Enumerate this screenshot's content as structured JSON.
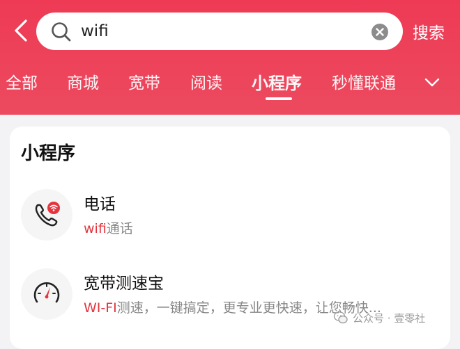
{
  "search": {
    "query": "wifi",
    "button_label": "搜索"
  },
  "tabs": [
    {
      "label": "全部",
      "active": false
    },
    {
      "label": "商城",
      "active": false
    },
    {
      "label": "宽带",
      "active": false
    },
    {
      "label": "阅读",
      "active": false
    },
    {
      "label": "小程序",
      "active": true
    },
    {
      "label": "秒懂联通",
      "active": false
    }
  ],
  "section": {
    "title": "小程序",
    "items": [
      {
        "title": "电话",
        "desc_highlight": "wifi",
        "desc_rest": "通话",
        "icon": "wifi-call-icon"
      },
      {
        "title": "宽带测速宝",
        "desc_highlight": "WI-FI",
        "desc_rest": "测速，一键搞定，更专业更快速，让您畅快...",
        "icon": "speedometer-icon"
      }
    ]
  },
  "watermark": {
    "text": "公众号 · 壹零社"
  },
  "colors": {
    "header": "#ee3a55",
    "highlight": "#e5343e",
    "card": "#ffffff"
  }
}
